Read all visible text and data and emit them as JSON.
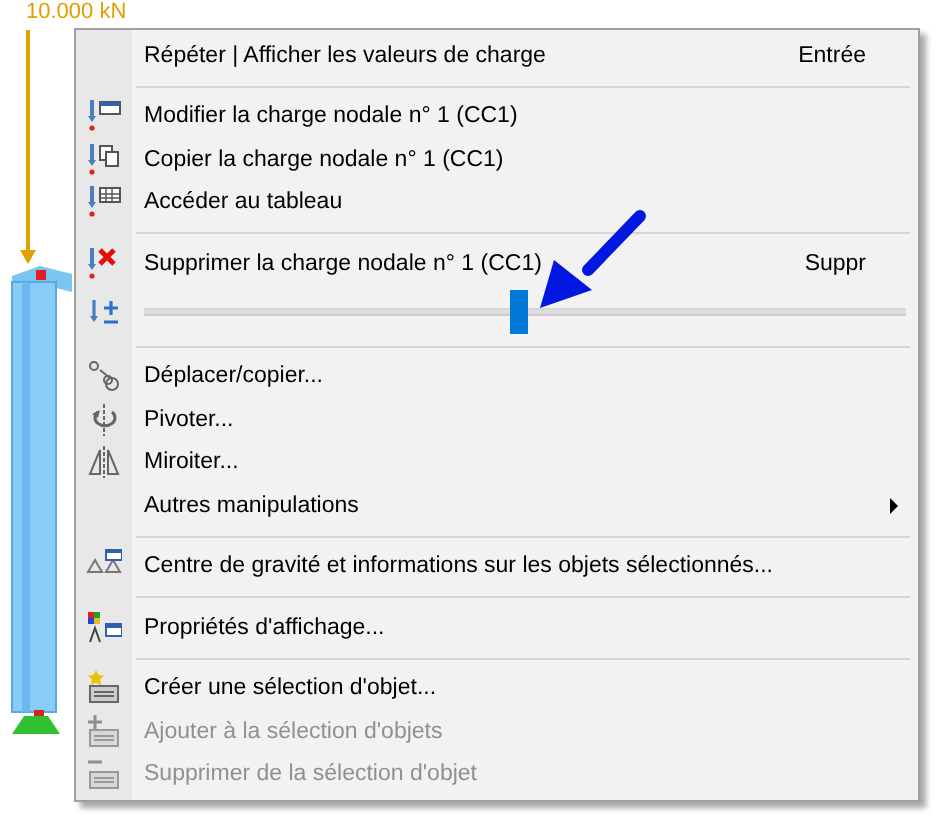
{
  "canvas": {
    "load_label": "10.000 kN"
  },
  "menu": {
    "items": [
      {
        "kind": "command",
        "label": "Répéter | Afficher les valeurs de charge",
        "shortcut": "Entrée",
        "disabled": false
      },
      {
        "kind": "separator"
      },
      {
        "kind": "command",
        "label": "Modifier la charge nodale n° 1 (CC1)",
        "disabled": false
      },
      {
        "kind": "command",
        "label": "Copier la charge nodale n° 1 (CC1)",
        "disabled": false
      },
      {
        "kind": "command",
        "label": "Accéder au tableau",
        "disabled": false
      },
      {
        "kind": "separator"
      },
      {
        "kind": "command",
        "label": "Supprimer la charge nodale n° 1 (CC1)",
        "shortcut": "Suppr",
        "disabled": false
      },
      {
        "kind": "slider",
        "level": 0.49
      },
      {
        "kind": "separator"
      },
      {
        "kind": "command",
        "label": "Déplacer/copier...",
        "disabled": false
      },
      {
        "kind": "command",
        "label": "Pivoter...",
        "disabled": false
      },
      {
        "kind": "command",
        "label": "Miroiter...",
        "disabled": false
      },
      {
        "kind": "command",
        "label": "Autres manipulations",
        "submenu": true,
        "disabled": false
      },
      {
        "kind": "separator"
      },
      {
        "kind": "command",
        "label": "Centre de gravité et informations sur les objets sélectionnés...",
        "disabled": false
      },
      {
        "kind": "separator"
      },
      {
        "kind": "command",
        "label": "Propriétés d'affichage...",
        "disabled": false
      },
      {
        "kind": "separator"
      },
      {
        "kind": "command",
        "label": "Créer une sélection d'objet...",
        "disabled": false
      },
      {
        "kind": "command",
        "label": "Ajouter à la sélection d'objets",
        "disabled": true
      },
      {
        "kind": "command",
        "label": "Supprimer de la sélection d'objet",
        "disabled": true
      }
    ]
  }
}
